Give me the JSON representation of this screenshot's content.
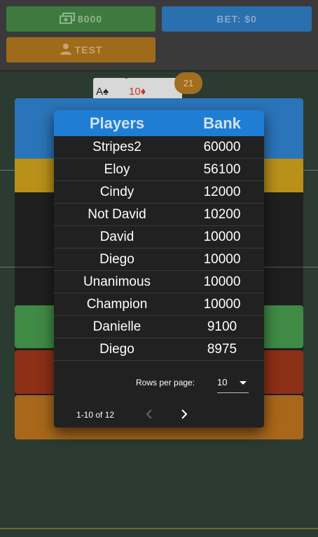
{
  "header": {
    "bank_amount": "8000",
    "bet_label": "BET: $0",
    "user_label": "TEST"
  },
  "table": {
    "card_a": "A♠",
    "card_b": "10♦",
    "score": "21"
  },
  "leaderboard": {
    "col_players": "Players",
    "col_bank": "Bank",
    "rows": [
      {
        "player": "Stripes2",
        "bank": "60000"
      },
      {
        "player": "Eloy",
        "bank": "56100"
      },
      {
        "player": "Cindy",
        "bank": "12000"
      },
      {
        "player": "Not David",
        "bank": "10200"
      },
      {
        "player": "David",
        "bank": "10000"
      },
      {
        "player": "Diego",
        "bank": "10000"
      },
      {
        "player": "Unanimous",
        "bank": "10000"
      },
      {
        "player": "Champion",
        "bank": "10000"
      },
      {
        "player": "Danielle",
        "bank": "9100"
      },
      {
        "player": "Diego",
        "bank": "8975"
      }
    ],
    "rows_per_page_label": "Rows per page:",
    "rows_per_page_value": "10",
    "range_text": "1-10 of 12"
  },
  "colors": {
    "accent_blue": "#1f7dd3",
    "bank_green": "#3e7a3e",
    "bet_blue": "#2a6fae",
    "user_orange": "#9e6b1a"
  },
  "icons": {
    "bank": "cash-icon",
    "user": "person-icon",
    "prev": "chevron-left-icon",
    "next": "chevron-right-icon",
    "select": "caret-down-icon"
  }
}
